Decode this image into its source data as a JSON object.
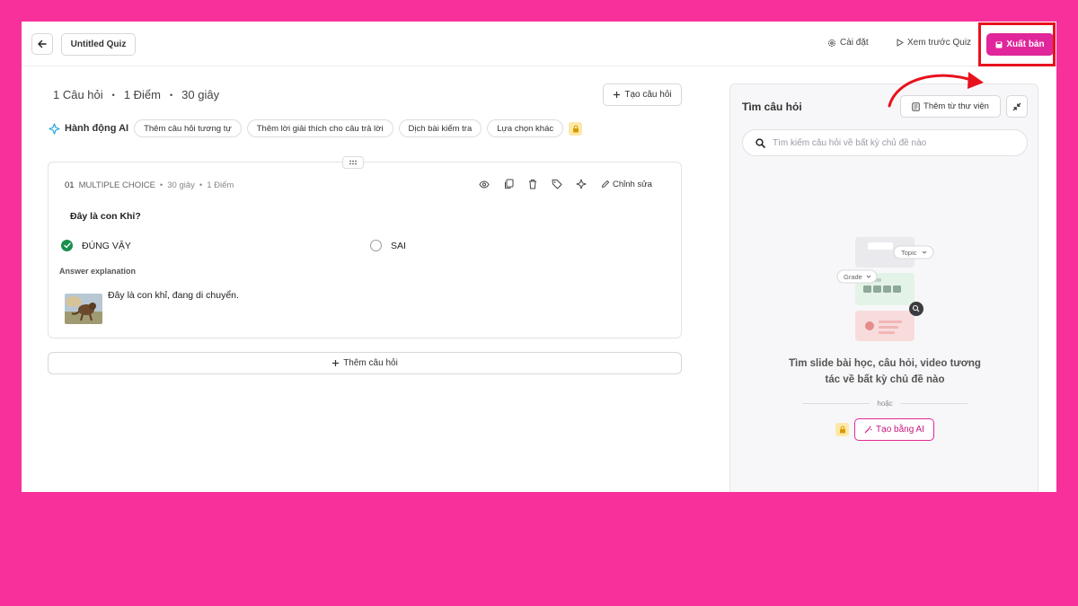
{
  "topbar": {
    "quiz_title": "Untitled Quiz",
    "settings_label": "Cài đặt",
    "preview_label": "Xem trước Quiz",
    "publish_label": "Xuất bản"
  },
  "summary": {
    "questions": "1 Câu hỏi",
    "points": "1 Điểm",
    "time": "30 giây",
    "create_question_label": "Tạo câu hỏi"
  },
  "ai_actions": {
    "label": "Hành động AI",
    "chips": [
      "Thêm câu hỏi tương tự",
      "Thêm lời giải thích cho câu trả lời",
      "Dịch bài kiểm tra",
      "Lựa chọn khác"
    ]
  },
  "question": {
    "number": "01",
    "type": "MULTIPLE CHOICE",
    "time": "30 giây",
    "points": "1 Điểm",
    "edit_label": "Chỉnh sửa",
    "text": "Đây là con Khỉ?",
    "options": [
      {
        "label": "ĐÚNG VẬY",
        "correct": true
      },
      {
        "label": "SAI",
        "correct": false
      }
    ],
    "explanation_label": "Answer explanation",
    "explanation_text": "Đây là con khỉ, đang di chuyển."
  },
  "add_question_label": "Thêm câu hỏi",
  "right_panel": {
    "title": "Tìm câu hỏi",
    "library_label": "Thêm từ thư viện",
    "search_placeholder": "Tìm kiếm câu hỏi về bất kỳ chủ đề nào",
    "illustration_topic": "Topic",
    "illustration_grade": "Grade",
    "description": "Tìm slide bài học, câu hỏi, video tương tác về bất kỳ chủ đề nào",
    "or_label": "hoặc",
    "ai_create_label": "Tạo bằng AI"
  },
  "colors": {
    "background": "#f7309b",
    "brand": "#e0269a",
    "correct": "#1a8f4d",
    "highlight": "#e8121d"
  }
}
